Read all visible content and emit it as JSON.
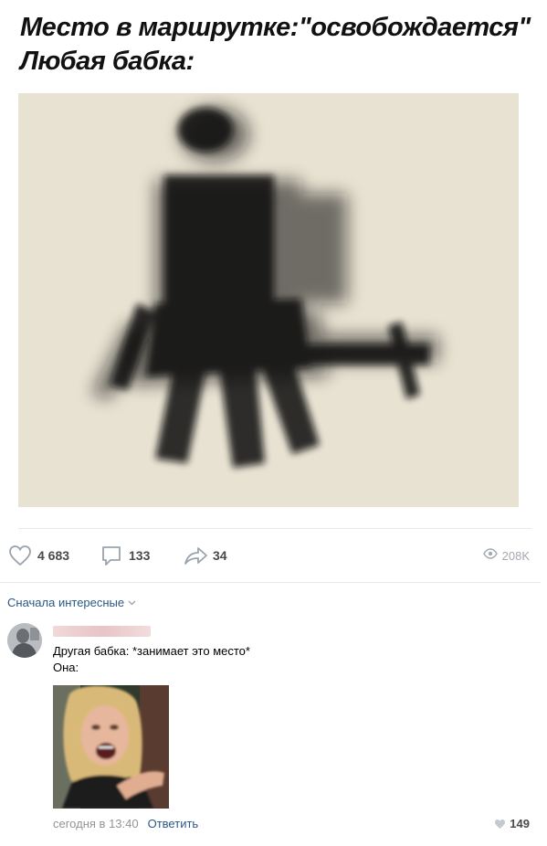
{
  "post": {
    "caption_line1": "Место в маршрутке:\"освобождается\"",
    "caption_line2": "Любая бабка:"
  },
  "actions": {
    "likes": "4 683",
    "comments": "133",
    "shares": "34",
    "views": "208K"
  },
  "comments_section": {
    "sort_label": "Сначала интересные",
    "comment": {
      "text_line1": "Другая бабка: *занимает это место*",
      "text_line2": "Она:",
      "time": "сегодня в 13:40",
      "reply_label": "Ответить",
      "likes": "149"
    }
  },
  "icons": {
    "like": "heart-icon",
    "comment": "comment-icon",
    "share": "share-arrow-icon",
    "views": "eye-icon",
    "sort": "chevron-down-icon"
  },
  "colors": {
    "link": "#2a5885",
    "icon": "#99a2ad",
    "meta": "#939393"
  }
}
